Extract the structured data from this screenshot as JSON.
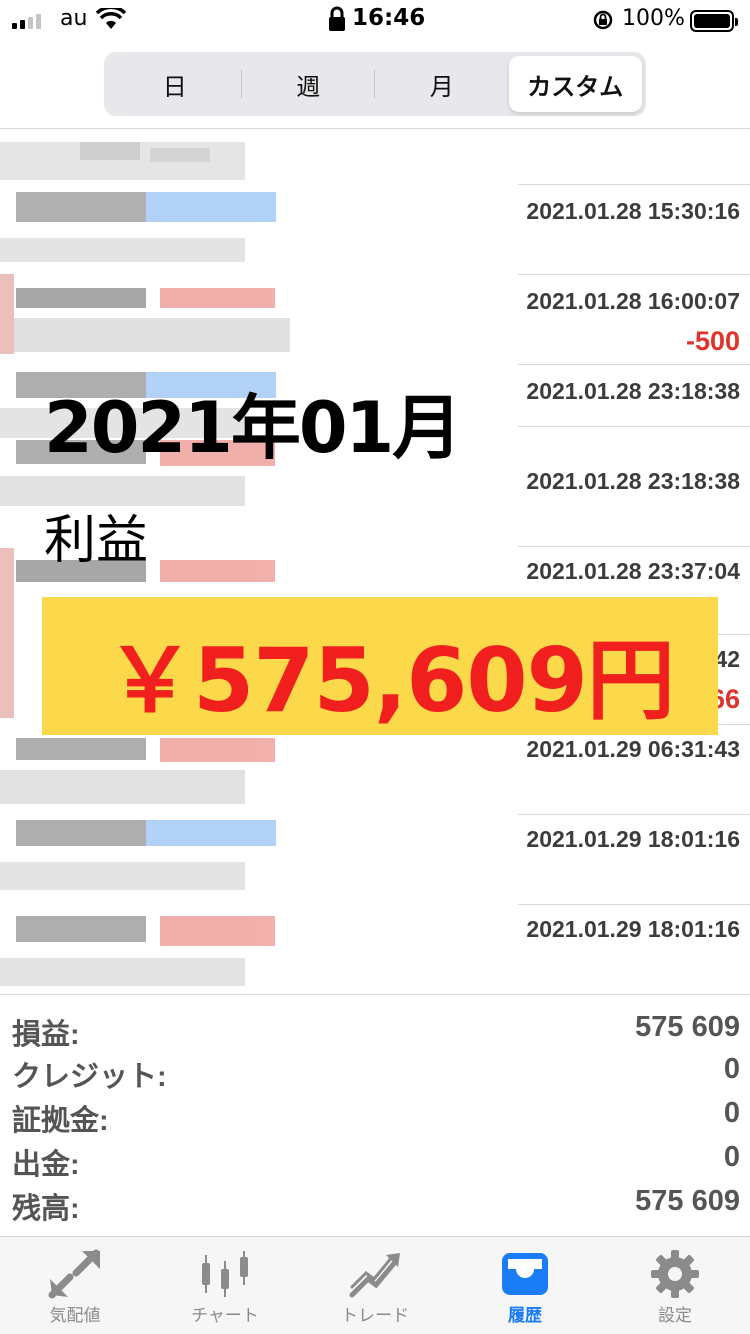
{
  "status_bar": {
    "carrier": "au",
    "time": "16:46",
    "battery": "100%"
  },
  "segments": [
    {
      "label": "日",
      "active": false
    },
    {
      "label": "週",
      "active": false
    },
    {
      "label": "月",
      "active": false
    },
    {
      "label": "カスタム",
      "active": true
    }
  ],
  "history": [
    {
      "time": "",
      "profit": ""
    },
    {
      "time": "2021.01.28 15:30:16",
      "profit": ""
    },
    {
      "time": "2021.01.28 16:00:07",
      "profit": "-500"
    },
    {
      "time": "2021.01.28 23:18:38",
      "profit": ""
    },
    {
      "time": "2021.01.28 23:18:38",
      "profit": ""
    },
    {
      "time": "2021.01.28 23:37:04",
      "profit": ""
    },
    {
      "time": "42",
      "profit": "66"
    },
    {
      "time": "2021.01.29 06:31:43",
      "profit": ""
    },
    {
      "time": "2021.01.29 18:01:16",
      "profit": ""
    },
    {
      "time": "2021.01.29 18:01:16",
      "profit": ""
    }
  ],
  "overlay": {
    "month": "2021年01月",
    "label": "利益",
    "amount": "￥575,609円"
  },
  "summary": [
    {
      "label": "損益:",
      "value": "575 609"
    },
    {
      "label": "クレジット:",
      "value": "0"
    },
    {
      "label": "証拠金:",
      "value": "0"
    },
    {
      "label": "出金:",
      "value": "0"
    },
    {
      "label": "残高:",
      "value": "575 609"
    }
  ],
  "tabs": [
    {
      "label": "気配値",
      "icon": "quotes-arrows-icon",
      "active": false
    },
    {
      "label": "チャート",
      "icon": "candlestick-chart-icon",
      "active": false
    },
    {
      "label": "トレード",
      "icon": "trade-trend-icon",
      "active": false
    },
    {
      "label": "履歴",
      "icon": "history-tray-icon",
      "active": true
    },
    {
      "label": "設定",
      "icon": "settings-gear-icon",
      "active": false
    }
  ],
  "colors": {
    "accent": "#1a7cf6",
    "loss": "#e0332b",
    "highlight_box": "#fbd94a",
    "highlight_text": "#f21f1f"
  }
}
